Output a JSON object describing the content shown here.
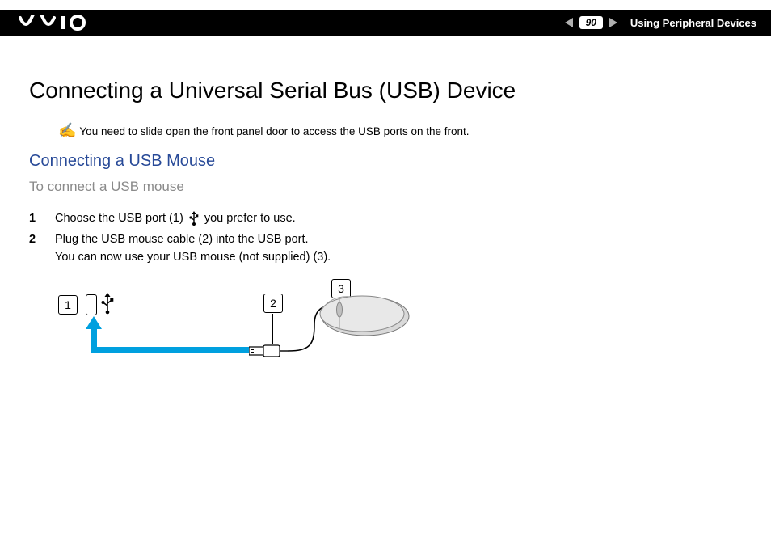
{
  "header": {
    "page_number": "90",
    "section": "Using Peripheral Devices"
  },
  "content": {
    "title": "Connecting a Universal Serial Bus (USB) Device",
    "note": "You need to slide open the front panel door to access the USB ports on the front.",
    "subtitle": "Connecting a USB Mouse",
    "procedure_title": "To connect a USB mouse",
    "steps": [
      {
        "num": "1",
        "text_before": "Choose the USB port (1) ",
        "text_after": " you prefer to use."
      },
      {
        "num": "2",
        "text_before": "Plug the USB mouse cable (2) into the USB port.",
        "text_after": "",
        "line2": "You can now use your USB mouse (not supplied) (3)."
      }
    ],
    "diagram_labels": {
      "l1": "1",
      "l2": "2",
      "l3": "3"
    }
  }
}
